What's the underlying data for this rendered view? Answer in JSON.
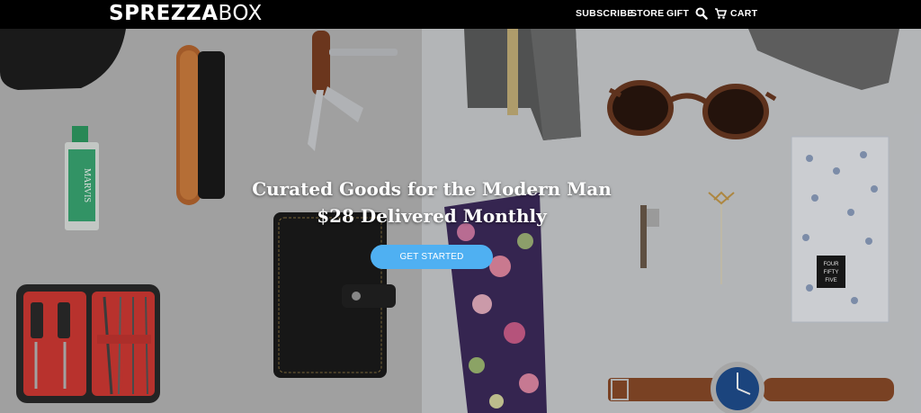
{
  "brand": {
    "logo_part1": "SPREZZA",
    "logo_part2": "BOX"
  },
  "nav": {
    "subscribe": "SUBSCRIBE",
    "store": "STORE",
    "gift": "GIFT",
    "search_icon": "search-icon",
    "cart_icon": "cart-icon",
    "cart": "CART"
  },
  "hero": {
    "headline_line1": "Curated Goods for the Modern Man",
    "headline_line2": "$28 Delivered Monthly",
    "cta_label": "GET STARTED",
    "cta_color": "#4fb0f2"
  },
  "products": {
    "toothpaste_brand": "MARVIS",
    "pocket_square_label": [
      "FOUR",
      "FIFTY",
      "FIVE"
    ]
  }
}
